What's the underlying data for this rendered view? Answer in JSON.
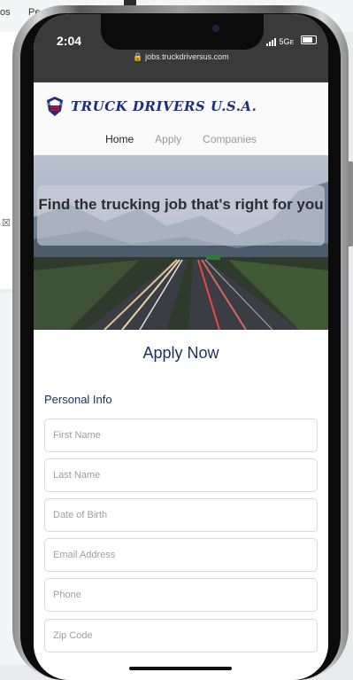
{
  "background": {
    "tab_fragment_1": "os",
    "tab_fragment_2": "Pe"
  },
  "status_bar": {
    "time": "2:04",
    "network": "5G",
    "network_suffix": "E",
    "url": "jobs.truckdriversus.com"
  },
  "site": {
    "brand": "TRUCK DRIVERS U.S.A.",
    "nav": {
      "home": "Home",
      "apply": "Apply",
      "companies": "Companies"
    },
    "hero_title": "Find the trucking job that's right for you",
    "apply_title": "Apply Now",
    "section_personal": "Personal Info"
  },
  "form": {
    "first_name_placeholder": "First Name",
    "last_name_placeholder": "Last Name",
    "dob_placeholder": "Date of Birth",
    "email_placeholder": "Email Address",
    "phone_placeholder": "Phone",
    "zip_placeholder": "Zip Code"
  },
  "colors": {
    "brand_navy": "#1b2f7a",
    "heading_navy": "#1b2f5a",
    "status_bar": "#3a3a3a"
  }
}
